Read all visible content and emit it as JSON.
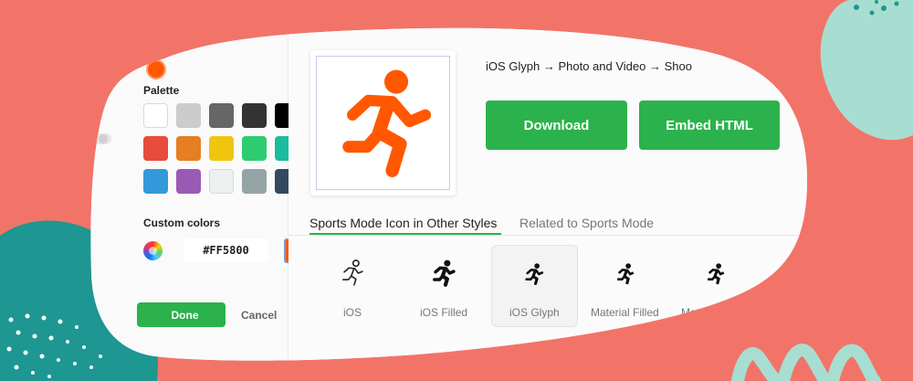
{
  "colors": {
    "background": "#F27468",
    "teal_blob": "#1E9691",
    "mint_blob": "#A8DED1",
    "accent_green": "#2BB24C",
    "icon_orange": "#FF5800"
  },
  "palette": {
    "label": "Palette",
    "swatches": [
      [
        "#FFFFFF",
        "#CCCCCC",
        "#666666",
        "#333333",
        "#000000"
      ],
      [
        "#E74C3C",
        "#E67E22",
        "#F1C40F",
        "#2ECC71",
        "#1ABC9C"
      ],
      [
        "#3498DB",
        "#9B59B6",
        "#ECF0F1",
        "#95A5A6",
        "#34495E"
      ]
    ]
  },
  "custom_colors": {
    "label": "Custom colors",
    "hex_value": "#FF5800",
    "selected_color": "#FF5800"
  },
  "actions": {
    "done_label": "Done",
    "cancel_label": "Cancel"
  },
  "preview": {
    "icon": "running-person-icon",
    "breadcrumb": "iOS Glyph → Photo and Video → Shoo",
    "download_label": "Download",
    "embed_label": "Embed HTML"
  },
  "tabs": [
    {
      "label": "Sports Mode Icon in Other Styles",
      "active": true
    },
    {
      "label": "Related to Sports Mode",
      "active": false
    }
  ],
  "styles": [
    {
      "label": "iOS",
      "icon": "running-person-outline-icon",
      "active": false
    },
    {
      "label": "iOS Filled",
      "icon": "running-person-filled-icon",
      "active": false
    },
    {
      "label": "iOS Glyph",
      "icon": "running-person-glyph-icon",
      "active": true
    },
    {
      "label": "Material Filled",
      "icon": "running-person-material-icon",
      "active": false
    },
    {
      "label": "Material",
      "icon": "running-person-material-outline-icon",
      "active": false
    }
  ]
}
